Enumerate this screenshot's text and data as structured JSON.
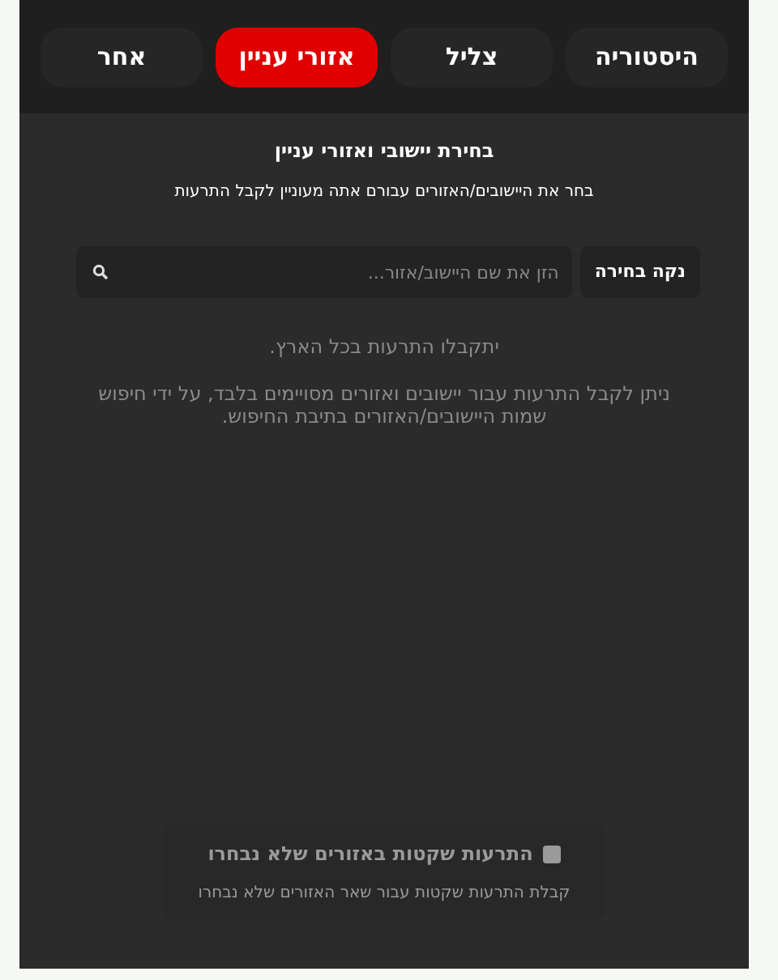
{
  "tabs": [
    {
      "label": "היסטוריה",
      "selected": false
    },
    {
      "label": "צליל",
      "selected": false
    },
    {
      "label": "אזורי עניין",
      "selected": true
    },
    {
      "label": "אחר",
      "selected": false
    }
  ],
  "heading": "בחירת יישובי ואזורי עניין",
  "subheading": "בחר את היישובים/האזורים עבורם אתה מעוניין לקבל התרעות",
  "clear_button": "נקה בחירה",
  "search": {
    "placeholder": "הזן את שם היישוב/אזור..."
  },
  "notice": "יתקבלו התרעות בכל הארץ.",
  "hint": "ניתן לקבל התרעות עבור יישובים ואזורים מסויימים בלבד, על ידי חיפוש שמות היישובים/האזורים בתיבת החיפוש.",
  "silent_option": {
    "label": "התרעות שקטות באזורים שלא נבחרו",
    "checked": false,
    "description": "קבלת התרעות שקטות עבור שאר האזורים שלא נבחרו"
  }
}
